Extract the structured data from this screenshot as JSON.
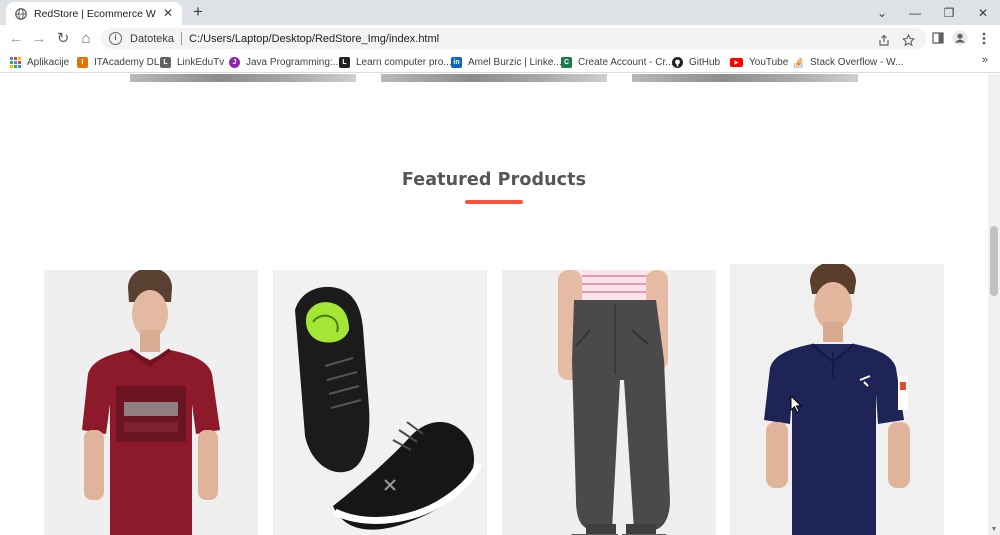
{
  "browser": {
    "tab": {
      "title": "RedStore | Ecommerce Website D",
      "close": "✕"
    },
    "new_tab": "+",
    "window_controls": {
      "dropdown": "⌄",
      "minimize": "—",
      "restore": "❐",
      "close": "✕"
    },
    "nav": {
      "back": "←",
      "forward": "→",
      "reload": "↻",
      "home": "⌂"
    },
    "address": {
      "scheme_label": "Datoteka",
      "url": "C:/Users/Laptop/Desktop/RedStore_Img/index.html"
    },
    "bookmarks": [
      {
        "label": "Aplikacije",
        "icon": "apps-grid-icon",
        "color": "#4285f4"
      },
      {
        "label": "ITAcademy DL",
        "icon": "itacademy-icon",
        "color": "#e8710a"
      },
      {
        "label": "LinkEduTv",
        "icon": "linkedutv-icon",
        "color": "#5f6368"
      },
      {
        "label": "Java Programming:...",
        "icon": "java-icon",
        "color": "#8e24aa"
      },
      {
        "label": "Learn computer pro...",
        "icon": "learn-icon",
        "color": "#202124"
      },
      {
        "label": "Amel Burzic | Linke...",
        "icon": "linkedin-icon",
        "color": "#0a66c2"
      },
      {
        "label": "Create Account - Cr...",
        "icon": "create-account-icon",
        "color": "#1e7a4c"
      },
      {
        "label": "GitHub",
        "icon": "github-icon",
        "color": "#202124"
      },
      {
        "label": "YouTube",
        "icon": "youtube-icon",
        "color": "#ff0000"
      },
      {
        "label": "Stack Overflow - W...",
        "icon": "stackoverflow-icon",
        "color": "#f48024"
      }
    ],
    "bookmarks_overflow": "»"
  },
  "page": {
    "section_title": "Featured Products",
    "accent_color": "#ff523b",
    "products": [
      {
        "name": "red-tshirt",
        "icon": "red-tshirt-image"
      },
      {
        "name": "black-shoes",
        "icon": "black-shoes-image"
      },
      {
        "name": "grey-joggers",
        "icon": "grey-joggers-image"
      },
      {
        "name": "navy-polo",
        "icon": "navy-polo-image"
      }
    ]
  }
}
